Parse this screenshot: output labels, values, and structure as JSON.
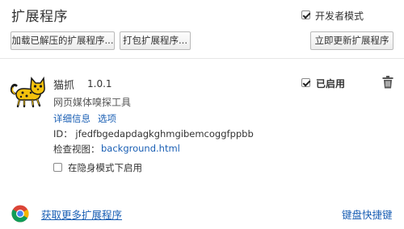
{
  "header": {
    "title": "扩展程序",
    "developer_mode_label": "开发者模式",
    "developer_mode_checked": true
  },
  "toolbar": {
    "load_unpacked_label": "加载已解压的扩展程序...",
    "pack_label": "打包扩展程序...",
    "update_now_label": "立即更新扩展程序"
  },
  "extension": {
    "name": "猫抓",
    "version": "1.0.1",
    "enabled_label": "已启用",
    "enabled_checked": true,
    "description": "网页媒体嗅探工具",
    "details_link": "详细信息",
    "options_link": "选项",
    "id_text": "ID：  jfedfbgedapdagkghmgibemcoggfppbb",
    "inspect_label": "检查视图：",
    "background_link": "background.html",
    "incognito_label": "在隐身模式下启用",
    "incognito_checked": false,
    "icon": "cat-icon",
    "delete_icon": "trash-icon"
  },
  "footer": {
    "get_more_label": "获取更多扩展程序",
    "shortcuts_label": "键盘快捷键",
    "chrome_icon": "chrome-icon"
  },
  "colors": {
    "link": "#1a5fb4",
    "text": "#333333",
    "cat_yellow": "#f4c20d"
  }
}
